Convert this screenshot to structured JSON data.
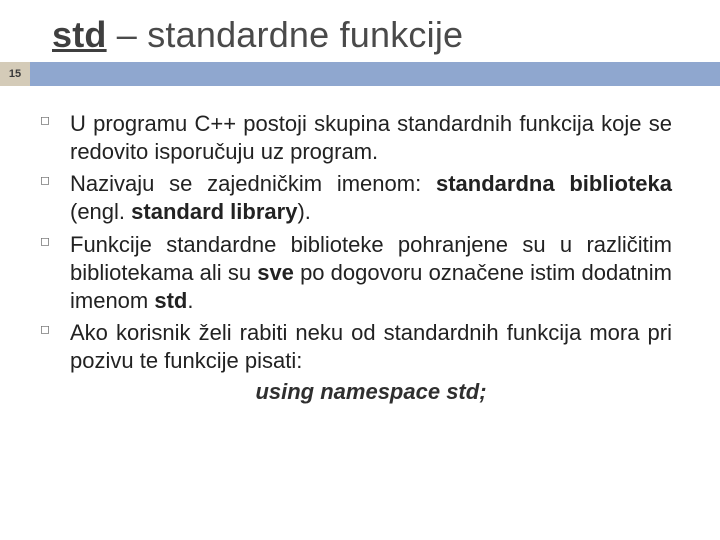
{
  "title": {
    "prefix": "std",
    "rest": " – standardne funkcije"
  },
  "slide_number": "15",
  "bullets": [
    {
      "html": "U programu C++ postoji skupina standardnih funkcija koje se redovito isporučuju uz program."
    },
    {
      "html": "Nazivaju se zajedničkim imenom: <span class=\"b\">standardna biblioteka</span> (engl. <span class=\"b\">standard library</span>)."
    },
    {
      "html": "Funkcije standardne biblioteke pohranjene su u različitim bibliotekama ali su <span class=\"b\">sve</span> po dogovoru označene istim dodatnim imenom <span class=\"b\">std</span>."
    },
    {
      "html": "Ako korisnik želi rabiti neku od standardnih funkcija mora pri pozivu te funkcije pisati:"
    }
  ],
  "code_line": "using namespace std;"
}
